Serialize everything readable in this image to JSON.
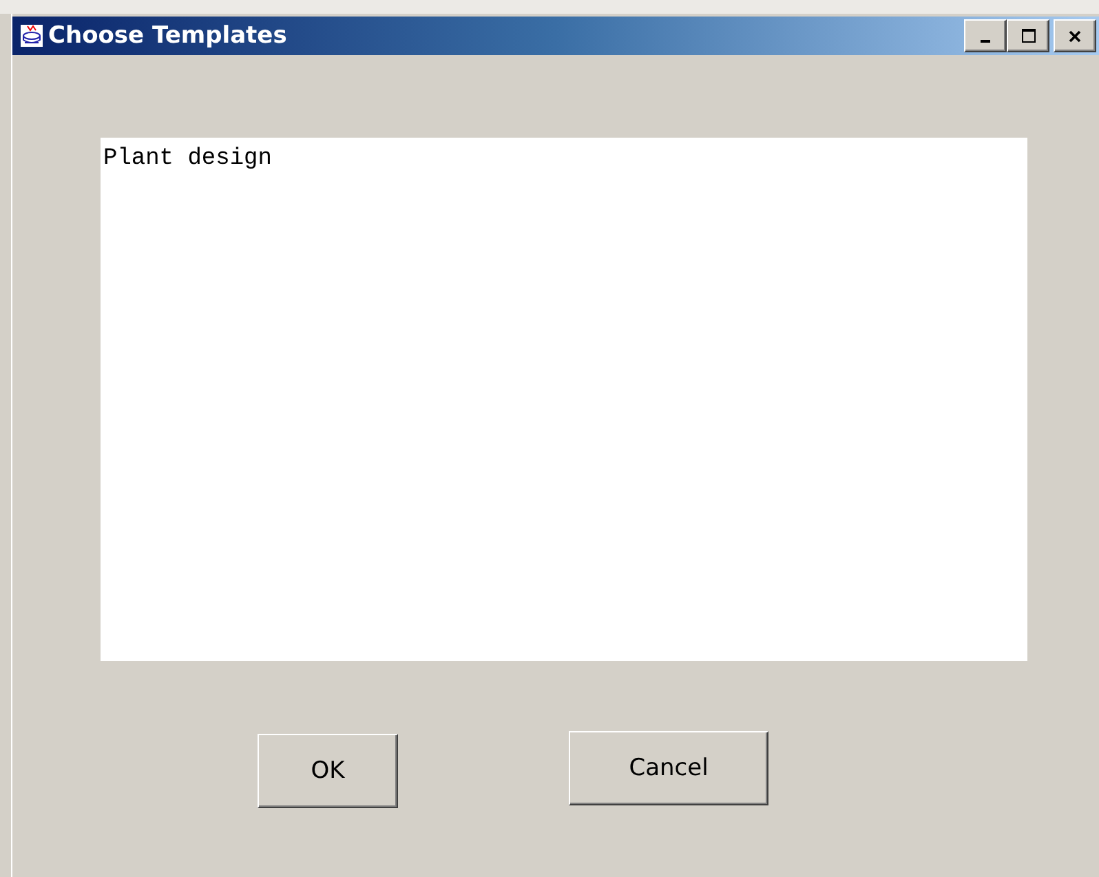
{
  "window": {
    "title": "Choose Templates"
  },
  "text_area": {
    "value": "Plant design"
  },
  "buttons": [
    {
      "label": "OK"
    },
    {
      "label": "Cancel"
    }
  ]
}
